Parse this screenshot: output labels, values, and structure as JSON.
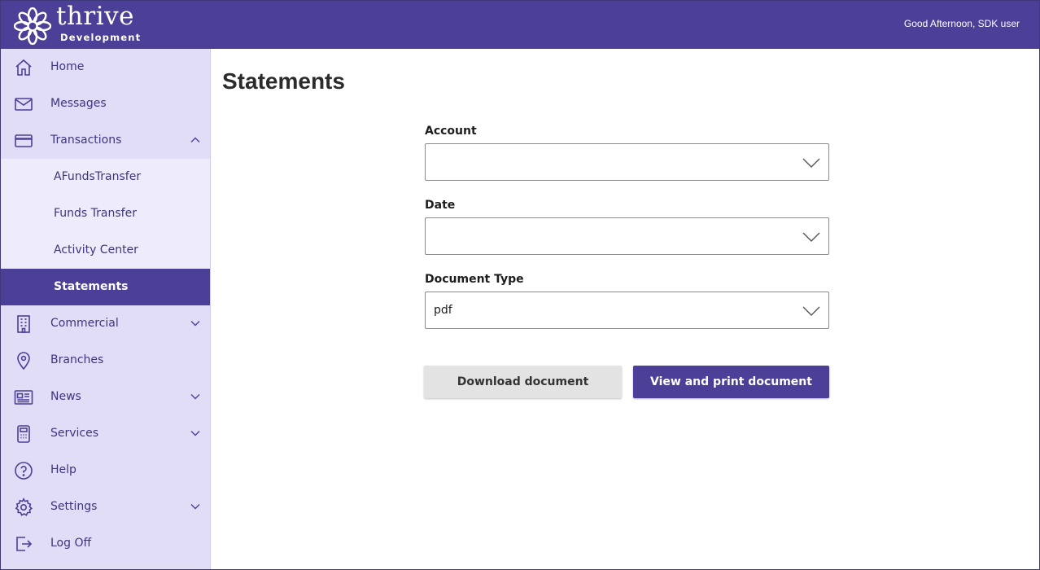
{
  "header": {
    "logo_word": "thrive",
    "logo_sub": "Development",
    "greeting": "Good Afternoon, SDK user",
    "brand_color": "#4b3f98"
  },
  "sidebar": {
    "items": [
      {
        "label": "Home",
        "icon": "home-icon"
      },
      {
        "label": "Messages",
        "icon": "mail-icon"
      },
      {
        "label": "Transactions",
        "icon": "credit-card-icon",
        "expanded": true
      },
      {
        "label": "Commercial",
        "icon": "building-icon",
        "expanded": false
      },
      {
        "label": "Branches",
        "icon": "map-pin-icon"
      },
      {
        "label": "News",
        "icon": "newspaper-icon",
        "expanded": false
      },
      {
        "label": "Services",
        "icon": "calculator-icon",
        "expanded": false
      },
      {
        "label": "Help",
        "icon": "help-circle-icon"
      },
      {
        "label": "Settings",
        "icon": "gear-icon",
        "expanded": false
      },
      {
        "label": "Log Off",
        "icon": "logout-icon"
      }
    ],
    "subitems": [
      {
        "label": "AFundsTransfer"
      },
      {
        "label": "Funds Transfer"
      },
      {
        "label": "Activity Center"
      },
      {
        "label": "Statements",
        "active": true
      }
    ]
  },
  "main": {
    "title": "Statements",
    "fields": {
      "account": {
        "label": "Account",
        "value": ""
      },
      "date": {
        "label": "Date",
        "value": ""
      },
      "document_type": {
        "label": "Document Type",
        "value": "pdf"
      }
    },
    "buttons": {
      "download": "Download document",
      "view_print": "View and print document"
    }
  }
}
